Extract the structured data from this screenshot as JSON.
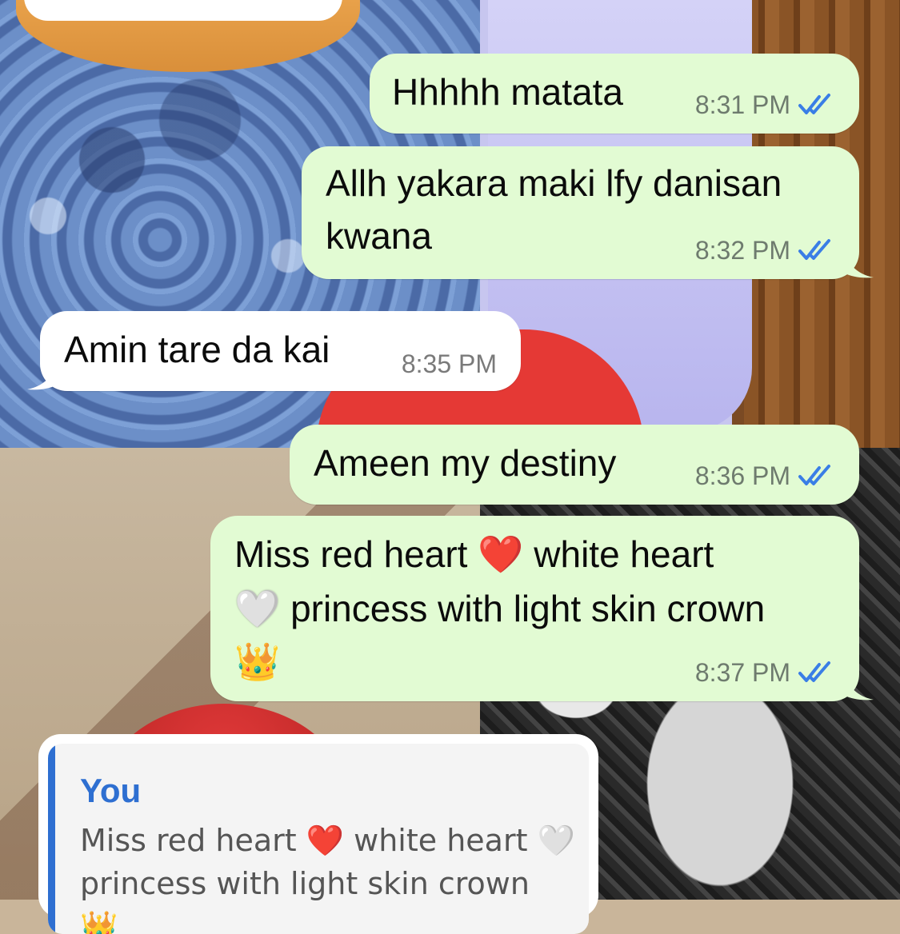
{
  "messages": [
    {
      "text": "Hhhhh matata",
      "time": "8:31 PM",
      "direction": "outgoing",
      "status": "read"
    },
    {
      "text_line1": "Allh yakara maki lfy danisan",
      "text_line2": "kwana",
      "time": "8:32 PM",
      "direction": "outgoing",
      "status": "read"
    },
    {
      "text": "Amin tare da kai",
      "time": "8:35 PM",
      "direction": "incoming"
    },
    {
      "text": "Ameen my destiny",
      "time": "8:36 PM",
      "direction": "outgoing",
      "status": "read"
    },
    {
      "line1_a": "Miss red heart",
      "line1_emoji": "❤️",
      "line1_b": "white heart",
      "line2_emoji": "🤍",
      "line2_b": "princess with light skin crown",
      "line3_emoji": "👑",
      "time": "8:37 PM",
      "direction": "outgoing",
      "status": "read"
    }
  ],
  "reply": {
    "author": "You",
    "line1": "Miss red heart ❤️ white heart 🤍",
    "line2": "princess with light skin crown 👑"
  },
  "colors": {
    "outgoing_bubble": "#e2fbd3",
    "incoming_bubble": "#ffffff",
    "read_ticks": "#3a7ee6",
    "reply_accent": "#2e6fd1"
  },
  "icons": {
    "read_receipt": "double-check-icon"
  }
}
